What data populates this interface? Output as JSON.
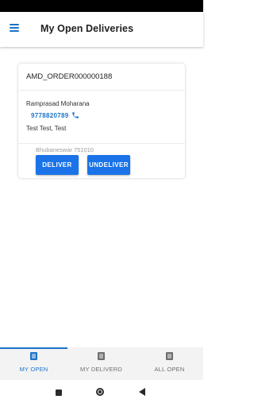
{
  "app_bar": {
    "title": "My Open Deliveries",
    "menu_icon": "hamburger-menu-icon"
  },
  "delivery": {
    "order_id": "AMD_ORDER000000188",
    "customer_name": "Ramprasad Moharana",
    "phone": "9778820789",
    "phone_icon": "phone-icon",
    "address": "Test Test, Test",
    "city": "Bhubaneswar 751010",
    "deliver_label": "DELIVER",
    "undeliver_label": "UNDELIVER"
  },
  "bottom_nav": {
    "items": [
      {
        "label": "MY OPEN",
        "icon": "list-icon",
        "active": true
      },
      {
        "label": "MY DELIVERD",
        "icon": "list-icon",
        "active": false
      },
      {
        "label": "ALL OPEN",
        "icon": "list-icon",
        "active": false
      }
    ]
  },
  "system_nav": {
    "icons": [
      "recents-square-icon",
      "home-circle-icon",
      "back-triangle-icon"
    ]
  },
  "colors": {
    "accent": "#1a73c8",
    "button": "#1a73e8",
    "status_bar": "#000000",
    "nav_background": "#f3f3f3"
  }
}
